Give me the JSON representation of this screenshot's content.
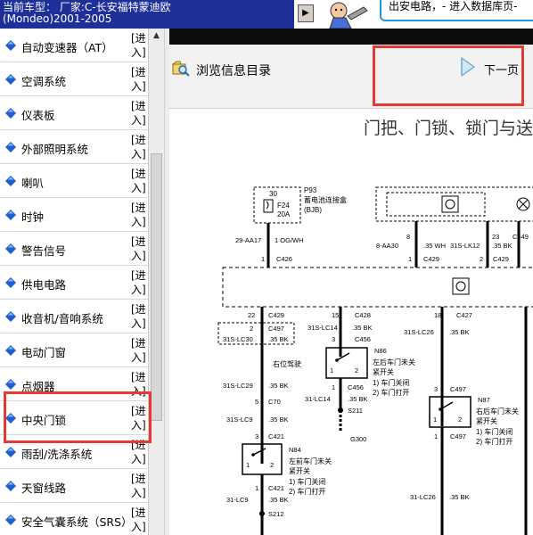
{
  "header": {
    "vehicle_line1": "当前车型： 厂家:C-长安福特蒙迪欧",
    "vehicle_line2": "(Mondeo)2001-2005",
    "banner_text": "出安电路，- 进入数据库页-",
    "arrow_icon": "right-arrow-icon",
    "colors": {
      "vehicle_bar": "#1e2f9a",
      "banner_border": "#1f9bd8"
    }
  },
  "sidebar": {
    "enter_label": "[进入]",
    "items": [
      {
        "label": "自动变速器（AT）"
      },
      {
        "label": "空调系统"
      },
      {
        "label": "仪表板"
      },
      {
        "label": "外部照明系统"
      },
      {
        "label": "喇叭"
      },
      {
        "label": "时钟"
      },
      {
        "label": "警告信号"
      },
      {
        "label": "供电电路"
      },
      {
        "label": "收音机/音响系统"
      },
      {
        "label": "电动门窗"
      },
      {
        "label": "点烟器"
      },
      {
        "label": "中央门锁",
        "highlighted": true
      },
      {
        "label": "雨刮/洗涤系统"
      },
      {
        "label": "天窗线路"
      },
      {
        "label": "安全气囊系统（SRS）"
      }
    ],
    "item_icon": "blue-diamond-icon",
    "colors": {
      "icon": "#1f5fd1",
      "highlight": "#e53935"
    }
  },
  "content": {
    "browse_label": "浏览信息目录",
    "next_label": "下一页",
    "diagram_title": "门把、门锁、锁门与送",
    "diagram": {
      "fuse_box": "P93",
      "fuse_box_name": "蓄电池连接盒",
      "fuse_box_code": "(BJB)",
      "fuse": "F24",
      "fuse_rating": "20A",
      "pin_30": "30",
      "pin_1": "1",
      "pin_8": "8",
      "pin_23": "23",
      "pin_22": "22",
      "pin_2": "2",
      "pin_15": "15",
      "pin_3": "3",
      "pin_18": "18",
      "pin_5": "5",
      "wire_aa17": "29-AA17",
      "wire_aa17_spec": "1 OG/WH",
      "wire_aa30": "8-AA30",
      "wire_aa30_spec": ".35 WH",
      "wire_lk12": "31S-LK12",
      "wire_lk12_spec": ".35 BK",
      "wire_lc30": "31S-LC30",
      "wire_lc14": "31S-LC14",
      "wire_lc26": "31S-LC26",
      "wire_lc29": "31S-LC29",
      "wire_lc14b": "31-LC14",
      "wire_lc9": "31S-LC9",
      "wire_lc9b": "31-LC9",
      "wire_lc26b": "31-LC26",
      "bk_35": ".35 BK",
      "conn_c426": "C426",
      "conn_c429": "C429",
      "conn_c449": "C449",
      "conn_c428": "C428",
      "conn_c456": "C456",
      "conn_c427": "C427",
      "conn_c70": "C70",
      "conn_c421": "C421",
      "conn_c497": "C497",
      "splice_s211": "S211",
      "splice_s212": "S212",
      "ground_g300": "G300",
      "n86": "N86",
      "n86_name1": "左后车门未关",
      "n86_name2": "紧开关",
      "n87": "N87",
      "n87_name1": "右后车门未关",
      "n87_name2": "紧开关",
      "n84": "N84",
      "n84_name1": "左前车门未关",
      "n84_name2": "紧开关",
      "right_side": "右位驾驶",
      "state_closed": "1) 车门关闭",
      "state_open": "2) 车门打开"
    }
  }
}
